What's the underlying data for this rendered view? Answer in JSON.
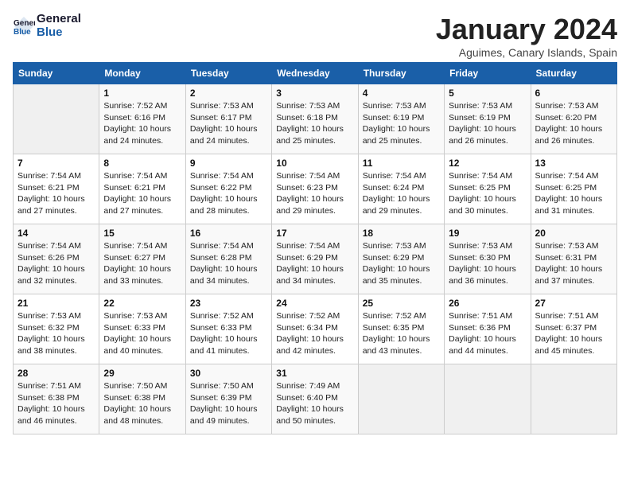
{
  "header": {
    "logo_general": "General",
    "logo_blue": "Blue",
    "title": "January 2024",
    "subtitle": "Aguimes, Canary Islands, Spain"
  },
  "days_of_week": [
    "Sunday",
    "Monday",
    "Tuesday",
    "Wednesday",
    "Thursday",
    "Friday",
    "Saturday"
  ],
  "weeks": [
    [
      {
        "day": "",
        "sunrise": "",
        "sunset": "",
        "daylight": ""
      },
      {
        "day": "1",
        "sunrise": "Sunrise: 7:52 AM",
        "sunset": "Sunset: 6:16 PM",
        "daylight": "Daylight: 10 hours and 24 minutes."
      },
      {
        "day": "2",
        "sunrise": "Sunrise: 7:53 AM",
        "sunset": "Sunset: 6:17 PM",
        "daylight": "Daylight: 10 hours and 24 minutes."
      },
      {
        "day": "3",
        "sunrise": "Sunrise: 7:53 AM",
        "sunset": "Sunset: 6:18 PM",
        "daylight": "Daylight: 10 hours and 25 minutes."
      },
      {
        "day": "4",
        "sunrise": "Sunrise: 7:53 AM",
        "sunset": "Sunset: 6:19 PM",
        "daylight": "Daylight: 10 hours and 25 minutes."
      },
      {
        "day": "5",
        "sunrise": "Sunrise: 7:53 AM",
        "sunset": "Sunset: 6:19 PM",
        "daylight": "Daylight: 10 hours and 26 minutes."
      },
      {
        "day": "6",
        "sunrise": "Sunrise: 7:53 AM",
        "sunset": "Sunset: 6:20 PM",
        "daylight": "Daylight: 10 hours and 26 minutes."
      }
    ],
    [
      {
        "day": "7",
        "sunrise": "Sunrise: 7:54 AM",
        "sunset": "Sunset: 6:21 PM",
        "daylight": "Daylight: 10 hours and 27 minutes."
      },
      {
        "day": "8",
        "sunrise": "Sunrise: 7:54 AM",
        "sunset": "Sunset: 6:21 PM",
        "daylight": "Daylight: 10 hours and 27 minutes."
      },
      {
        "day": "9",
        "sunrise": "Sunrise: 7:54 AM",
        "sunset": "Sunset: 6:22 PM",
        "daylight": "Daylight: 10 hours and 28 minutes."
      },
      {
        "day": "10",
        "sunrise": "Sunrise: 7:54 AM",
        "sunset": "Sunset: 6:23 PM",
        "daylight": "Daylight: 10 hours and 29 minutes."
      },
      {
        "day": "11",
        "sunrise": "Sunrise: 7:54 AM",
        "sunset": "Sunset: 6:24 PM",
        "daylight": "Daylight: 10 hours and 29 minutes."
      },
      {
        "day": "12",
        "sunrise": "Sunrise: 7:54 AM",
        "sunset": "Sunset: 6:25 PM",
        "daylight": "Daylight: 10 hours and 30 minutes."
      },
      {
        "day": "13",
        "sunrise": "Sunrise: 7:54 AM",
        "sunset": "Sunset: 6:25 PM",
        "daylight": "Daylight: 10 hours and 31 minutes."
      }
    ],
    [
      {
        "day": "14",
        "sunrise": "Sunrise: 7:54 AM",
        "sunset": "Sunset: 6:26 PM",
        "daylight": "Daylight: 10 hours and 32 minutes."
      },
      {
        "day": "15",
        "sunrise": "Sunrise: 7:54 AM",
        "sunset": "Sunset: 6:27 PM",
        "daylight": "Daylight: 10 hours and 33 minutes."
      },
      {
        "day": "16",
        "sunrise": "Sunrise: 7:54 AM",
        "sunset": "Sunset: 6:28 PM",
        "daylight": "Daylight: 10 hours and 34 minutes."
      },
      {
        "day": "17",
        "sunrise": "Sunrise: 7:54 AM",
        "sunset": "Sunset: 6:29 PM",
        "daylight": "Daylight: 10 hours and 34 minutes."
      },
      {
        "day": "18",
        "sunrise": "Sunrise: 7:53 AM",
        "sunset": "Sunset: 6:29 PM",
        "daylight": "Daylight: 10 hours and 35 minutes."
      },
      {
        "day": "19",
        "sunrise": "Sunrise: 7:53 AM",
        "sunset": "Sunset: 6:30 PM",
        "daylight": "Daylight: 10 hours and 36 minutes."
      },
      {
        "day": "20",
        "sunrise": "Sunrise: 7:53 AM",
        "sunset": "Sunset: 6:31 PM",
        "daylight": "Daylight: 10 hours and 37 minutes."
      }
    ],
    [
      {
        "day": "21",
        "sunrise": "Sunrise: 7:53 AM",
        "sunset": "Sunset: 6:32 PM",
        "daylight": "Daylight: 10 hours and 38 minutes."
      },
      {
        "day": "22",
        "sunrise": "Sunrise: 7:53 AM",
        "sunset": "Sunset: 6:33 PM",
        "daylight": "Daylight: 10 hours and 40 minutes."
      },
      {
        "day": "23",
        "sunrise": "Sunrise: 7:52 AM",
        "sunset": "Sunset: 6:33 PM",
        "daylight": "Daylight: 10 hours and 41 minutes."
      },
      {
        "day": "24",
        "sunrise": "Sunrise: 7:52 AM",
        "sunset": "Sunset: 6:34 PM",
        "daylight": "Daylight: 10 hours and 42 minutes."
      },
      {
        "day": "25",
        "sunrise": "Sunrise: 7:52 AM",
        "sunset": "Sunset: 6:35 PM",
        "daylight": "Daylight: 10 hours and 43 minutes."
      },
      {
        "day": "26",
        "sunrise": "Sunrise: 7:51 AM",
        "sunset": "Sunset: 6:36 PM",
        "daylight": "Daylight: 10 hours and 44 minutes."
      },
      {
        "day": "27",
        "sunrise": "Sunrise: 7:51 AM",
        "sunset": "Sunset: 6:37 PM",
        "daylight": "Daylight: 10 hours and 45 minutes."
      }
    ],
    [
      {
        "day": "28",
        "sunrise": "Sunrise: 7:51 AM",
        "sunset": "Sunset: 6:38 PM",
        "daylight": "Daylight: 10 hours and 46 minutes."
      },
      {
        "day": "29",
        "sunrise": "Sunrise: 7:50 AM",
        "sunset": "Sunset: 6:38 PM",
        "daylight": "Daylight: 10 hours and 48 minutes."
      },
      {
        "day": "30",
        "sunrise": "Sunrise: 7:50 AM",
        "sunset": "Sunset: 6:39 PM",
        "daylight": "Daylight: 10 hours and 49 minutes."
      },
      {
        "day": "31",
        "sunrise": "Sunrise: 7:49 AM",
        "sunset": "Sunset: 6:40 PM",
        "daylight": "Daylight: 10 hours and 50 minutes."
      },
      {
        "day": "",
        "sunrise": "",
        "sunset": "",
        "daylight": ""
      },
      {
        "day": "",
        "sunrise": "",
        "sunset": "",
        "daylight": ""
      },
      {
        "day": "",
        "sunrise": "",
        "sunset": "",
        "daylight": ""
      }
    ]
  ]
}
